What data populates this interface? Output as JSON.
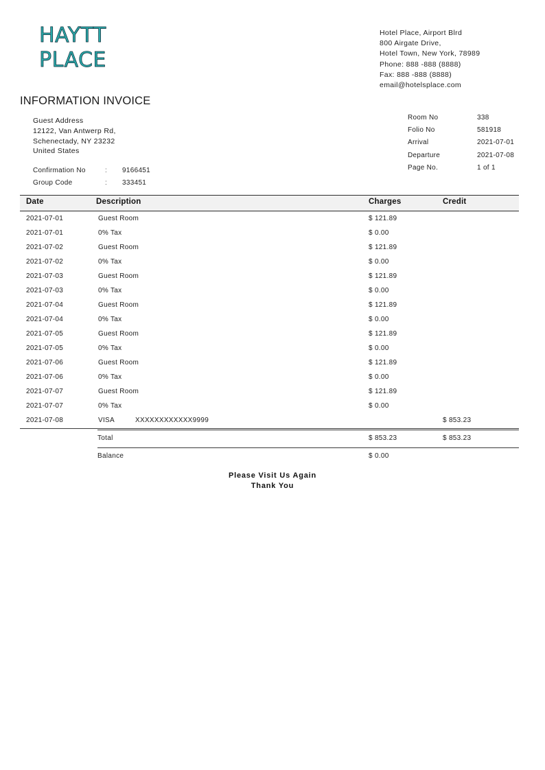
{
  "logo": {
    "line1": "HAYTT",
    "line2": "PLACE",
    "color": "#2ba8a8",
    "outline_color": "#12333f"
  },
  "hotel": {
    "address_lines": [
      "Hotel Place, Airport Blrd",
      "800 Airgate Drive,",
      "Hotel Town, New York, 78989",
      "Phone: 888 -888 (8888)",
      "Fax: 888 -888 (8888)",
      "email@hotelsplace.com"
    ]
  },
  "document": {
    "title": "INFORMATION INVOICE"
  },
  "guest": {
    "heading": "Guest Address",
    "address_lines": [
      "12122, Van Antwerp Rd,",
      "Schenectady, NY 23232",
      "United States"
    ],
    "fields": [
      {
        "label": "Confirmation No",
        "colon": ":",
        "value": "9166451"
      },
      {
        "label": "Group Code",
        "colon": ":",
        "value": "333451"
      }
    ]
  },
  "stay_info": [
    {
      "label": "Room No",
      "value": "338"
    },
    {
      "label": "Folio No",
      "value": "581918"
    },
    {
      "label": "Arrival",
      "value": "2021-07-01"
    },
    {
      "label": "Departure",
      "value": "2021-07-08"
    },
    {
      "label": "Page No.",
      "value": "1 of 1"
    }
  ],
  "table": {
    "headers": {
      "date": "Date",
      "description": "Description",
      "charges": "Charges",
      "credit": "Credit"
    },
    "rows": [
      {
        "date": "2021-07-01",
        "description": "Guest Room",
        "description2": "",
        "charges": "$ 121.89",
        "credit": ""
      },
      {
        "date": "2021-07-01",
        "description": "0% Tax",
        "description2": "",
        "charges": "$ 0.00",
        "credit": ""
      },
      {
        "date": "2021-07-02",
        "description": "Guest Room",
        "description2": "",
        "charges": "$ 121.89",
        "credit": ""
      },
      {
        "date": "2021-07-02",
        "description": "0% Tax",
        "description2": "",
        "charges": "$ 0.00",
        "credit": ""
      },
      {
        "date": "2021-07-03",
        "description": "Guest Room",
        "description2": "",
        "charges": "$ 121.89",
        "credit": ""
      },
      {
        "date": "2021-07-03",
        "description": "0% Tax",
        "description2": "",
        "charges": "$ 0.00",
        "credit": ""
      },
      {
        "date": "2021-07-04",
        "description": "Guest Room",
        "description2": "",
        "charges": "$ 121.89",
        "credit": ""
      },
      {
        "date": "2021-07-04",
        "description": "0% Tax",
        "description2": "",
        "charges": "$ 0.00",
        "credit": ""
      },
      {
        "date": "2021-07-05",
        "description": "Guest Room",
        "description2": "",
        "charges": "$ 121.89",
        "credit": ""
      },
      {
        "date": "2021-07-05",
        "description": "0% Tax",
        "description2": "",
        "charges": "$ 0.00",
        "credit": ""
      },
      {
        "date": "2021-07-06",
        "description": "Guest Room",
        "description2": "",
        "charges": "$ 121.89",
        "credit": ""
      },
      {
        "date": "2021-07-06",
        "description": "0% Tax",
        "description2": "",
        "charges": "$ 0.00",
        "credit": ""
      },
      {
        "date": "2021-07-07",
        "description": "Guest Room",
        "description2": "",
        "charges": "$ 121.89",
        "credit": ""
      },
      {
        "date": "2021-07-07",
        "description": "0% Tax",
        "description2": "",
        "charges": "$ 0.00",
        "credit": ""
      },
      {
        "date": "2021-07-08",
        "description": "VISA",
        "description2": "XXXXXXXXXXXX9999",
        "charges": "",
        "credit": "$ 853.23"
      }
    ]
  },
  "totals": [
    {
      "label": "Total",
      "charges": "$ 853.23",
      "credit": "$ 853.23"
    },
    {
      "label": "Balance",
      "charges": "$ 0.00",
      "credit": ""
    }
  ],
  "footer": {
    "line1": "Please Visit Us Again",
    "line2": "Thank You"
  }
}
